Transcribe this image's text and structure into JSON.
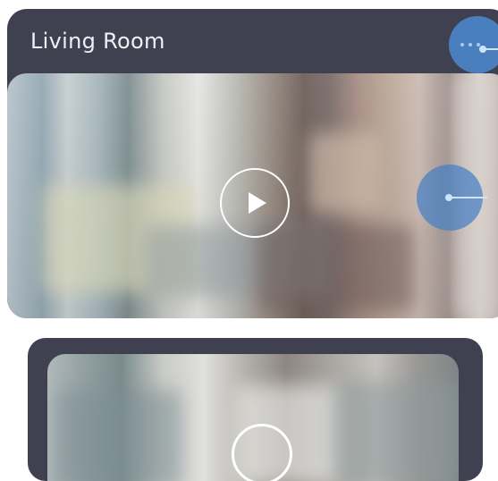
{
  "cards": [
    {
      "title": "Living Room",
      "more_icon": "more-horizontal-icon",
      "video": {
        "play_icon": "play-icon"
      }
    },
    {
      "title": "",
      "video": {
        "play_icon": "play-icon"
      }
    }
  ],
  "colors": {
    "card_bg": "#404150",
    "title_text": "#eef0f6",
    "hotspot": "#4a84c6",
    "play": "#ffffff"
  }
}
